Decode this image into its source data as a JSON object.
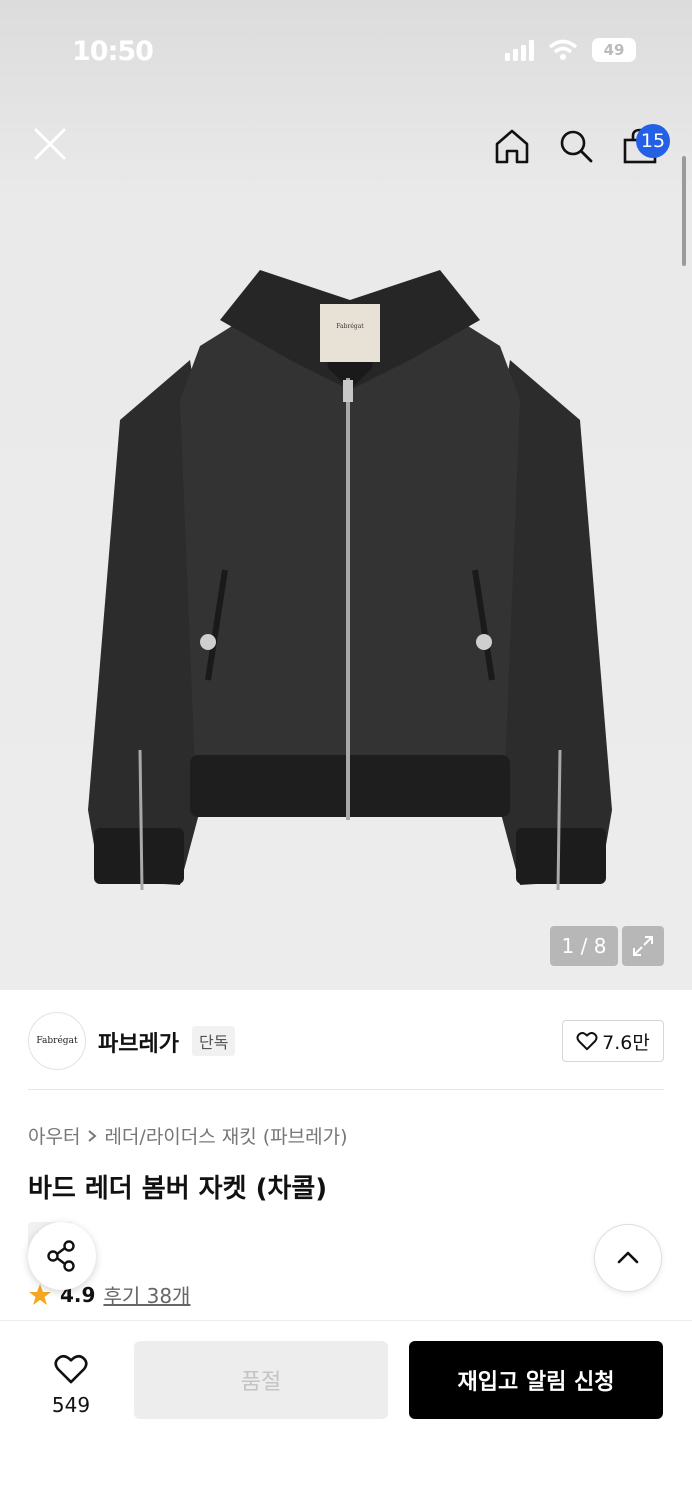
{
  "status_bar": {
    "time": "10:50",
    "battery": "49"
  },
  "nav": {
    "close_icon": "close-icon",
    "home_icon": "home-icon",
    "search_icon": "search-icon",
    "cart_icon": "shopping-bag-icon",
    "cart_count": "15"
  },
  "gallery": {
    "counter": "1 / 8",
    "image_label": "Fabrégat"
  },
  "brand": {
    "logo_text": "Fabrégat",
    "name": "파브레가",
    "tag": "단독",
    "likes": "7.6만"
  },
  "product": {
    "breadcrumb": [
      "아우터",
      "레더/라이더스 재킷 (파브레가)"
    ],
    "title": "바드 레더 봄버 자켓 (차콜)",
    "tag": "단독",
    "rating": "4.9",
    "reviews": "후기 38개"
  },
  "bottom": {
    "wish_count": "549",
    "soldout_label": "품절",
    "restock_label": "재입고 알림 신청"
  },
  "colors": {
    "accent": "#2460e6",
    "star": "#f5a623",
    "primary_button": "#000000"
  }
}
